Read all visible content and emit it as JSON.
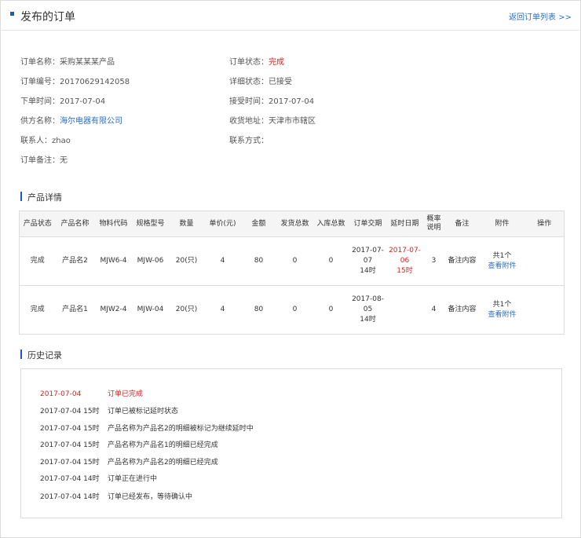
{
  "header": {
    "title": "发布的订单",
    "back_link": "返回订单列表 >>"
  },
  "order_info": [
    {
      "label": "订单名称：",
      "value": "采购某某某产品",
      "style": ""
    },
    {
      "label": "订单状态：",
      "value": "完成",
      "style": "red"
    },
    {
      "label": "订单编号：",
      "value": "20170629142058",
      "style": ""
    },
    {
      "label": "详细状态：",
      "value": "已接受",
      "style": ""
    },
    {
      "label": "下单时间：",
      "value": "2017-07-04",
      "style": ""
    },
    {
      "label": "接受时间：",
      "value": "2017-07-04",
      "style": ""
    },
    {
      "label": "供方名称：",
      "value": "海尔电器有限公司",
      "style": "blue"
    },
    {
      "label": "收货地址：",
      "value": "天津市市辖区",
      "style": ""
    },
    {
      "label": "联系人：",
      "value": "zhao",
      "style": ""
    },
    {
      "label": "联系方式：",
      "value": "",
      "style": ""
    },
    {
      "label": "订单备注：",
      "value": "无",
      "style": ""
    }
  ],
  "product_section": {
    "title": "产品详情"
  },
  "product_table": {
    "columns": [
      "产品状态",
      "产品名称",
      "物料代码",
      "规格型号",
      "数量",
      "单价(元)",
      "金额",
      "发货总数",
      "入库总数",
      "订单交期",
      "延时日期",
      "概率\n说明",
      "备注",
      "附件",
      "操作"
    ],
    "rows": [
      {
        "status": "完成",
        "name": "产品名2",
        "code": "MJW6-4",
        "spec": "MJW-06",
        "qty": "20(只)",
        "price": "4",
        "amount": "80",
        "shipped": "0",
        "stored": "0",
        "delivery_date": "2017-07-07",
        "delivery_time": "14时",
        "delay_date": "2017-07-06",
        "delay_time": "15时",
        "prob": "3",
        "remark": "备注内容",
        "attach_count": "共1个",
        "attach_link": "查看附件"
      },
      {
        "status": "完成",
        "name": "产品名1",
        "code": "MJW2-4",
        "spec": "MJW-04",
        "qty": "20(只)",
        "price": "4",
        "amount": "80",
        "shipped": "0",
        "stored": "0",
        "delivery_date": "2017-08-05",
        "delivery_time": "14时",
        "delay_date": "",
        "delay_time": "",
        "prob": "4",
        "remark": "备注内容",
        "attach_count": "共1个",
        "attach_link": "查看附件"
      }
    ]
  },
  "history_section": {
    "title": "历史记录"
  },
  "history": [
    {
      "time": "2017-07-04",
      "text": "订单已完成"
    },
    {
      "time": "2017-07-04 15时",
      "text": "订单已被标记延时状态"
    },
    {
      "time": "2017-07-04 15时",
      "text": "产品名称为产品名2的明细被标记为继续延时中"
    },
    {
      "time": "2017-07-04 15时",
      "text": "产品名称为产品名1的明细已经完成"
    },
    {
      "time": "2017-07-04 15时",
      "text": "产品名称为产品名2的明细已经完成"
    },
    {
      "time": "2017-07-04 14时",
      "text": "订单正在进行中"
    },
    {
      "time": "2017-07-04 14时",
      "text": "订单已经发布，等待确认中"
    }
  ],
  "colors": {
    "accent": "#1a5bbf",
    "link": "#2a6ec8",
    "alert": "#e02020"
  }
}
